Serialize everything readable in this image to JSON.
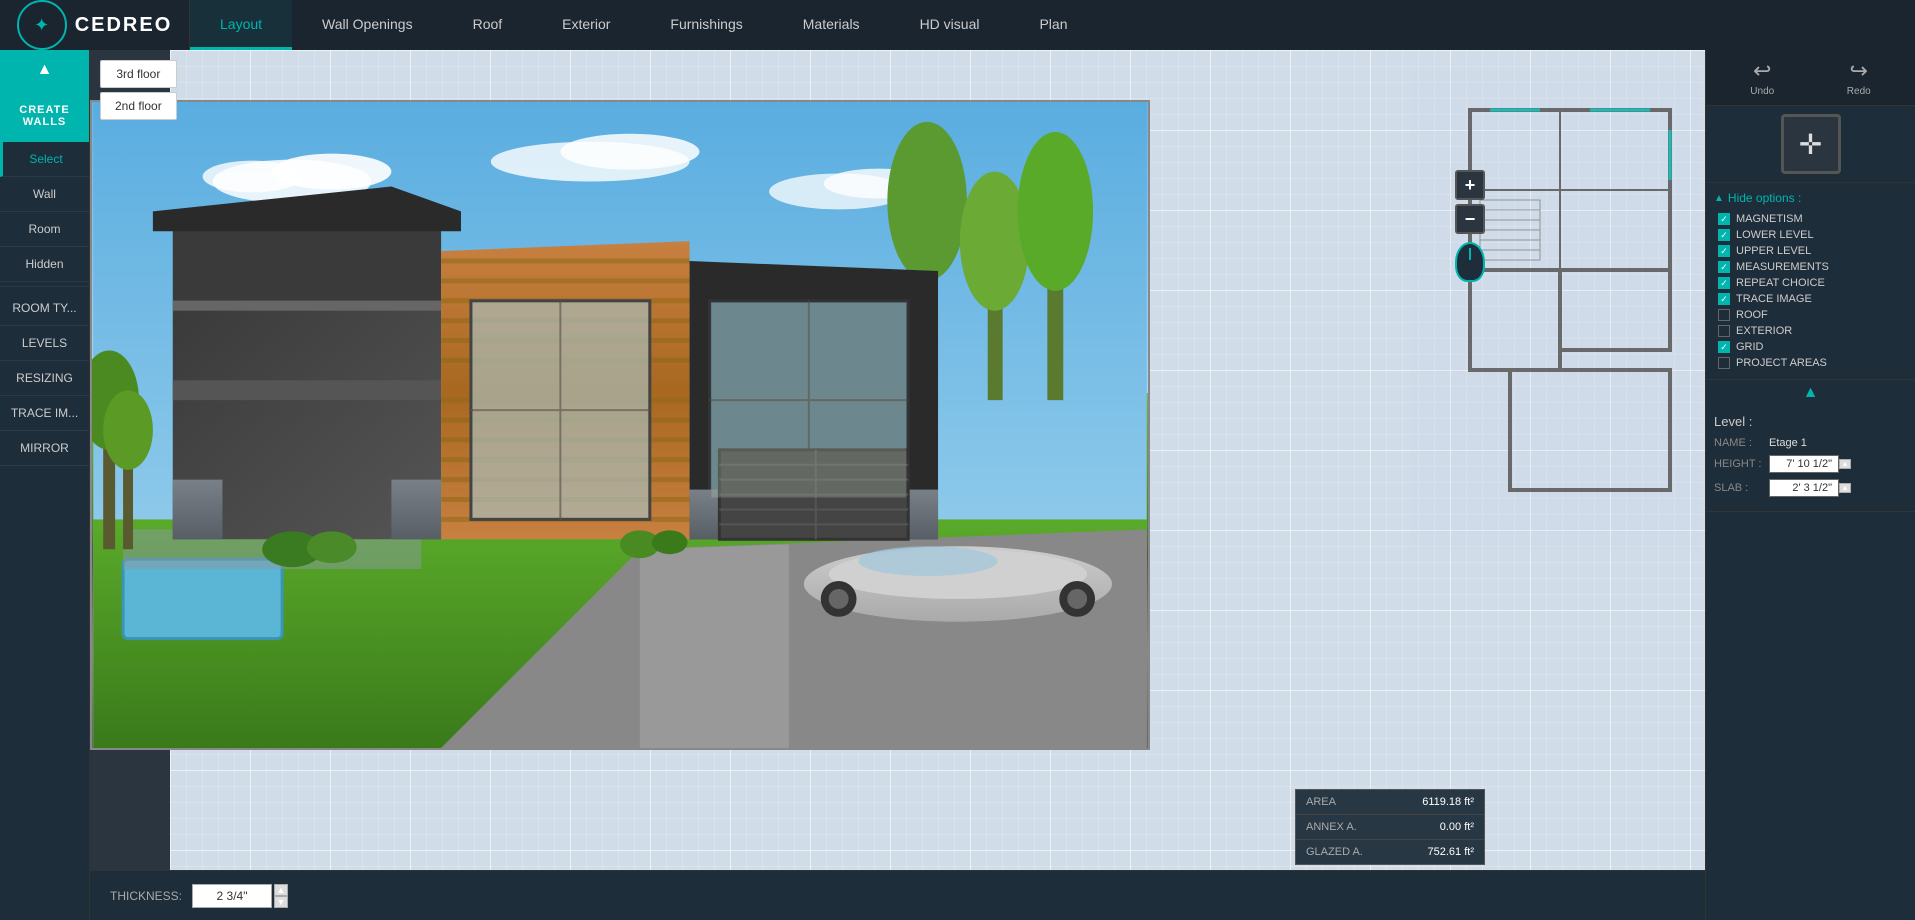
{
  "logo": {
    "text": "CEDREO"
  },
  "nav": {
    "tabs": [
      {
        "id": "layout",
        "label": "Layout",
        "active": true
      },
      {
        "id": "wall-openings",
        "label": "Wall Openings",
        "active": false
      },
      {
        "id": "roof",
        "label": "Roof",
        "active": false
      },
      {
        "id": "exterior",
        "label": "Exterior",
        "active": false
      },
      {
        "id": "furnishings",
        "label": "Furnishings",
        "active": false
      },
      {
        "id": "materials",
        "label": "Materials",
        "active": false
      },
      {
        "id": "hd-visual",
        "label": "HD visual",
        "active": false
      },
      {
        "id": "plan",
        "label": "Plan",
        "active": false
      }
    ]
  },
  "sidebar": {
    "create_walls_label": "CREATE WALLS",
    "items": [
      {
        "id": "select",
        "label": "Select",
        "active": true
      },
      {
        "id": "wall",
        "label": "Wall",
        "active": false
      },
      {
        "id": "room",
        "label": "Room",
        "active": false
      },
      {
        "id": "hidden",
        "label": "Hidden",
        "active": false
      },
      {
        "id": "room-type",
        "label": "ROOM TY...",
        "active": false
      },
      {
        "id": "levels",
        "label": "LEVELS",
        "active": false
      },
      {
        "id": "resizing",
        "label": "RESIZING",
        "active": false
      },
      {
        "id": "trace-image",
        "label": "TRACE IM...",
        "active": false
      },
      {
        "id": "mirror",
        "label": "MIRROR",
        "active": false
      }
    ]
  },
  "floors": [
    {
      "id": "3rd",
      "label": "3rd floor"
    },
    {
      "id": "2nd",
      "label": "2nd floor"
    }
  ],
  "undo_redo": {
    "undo_label": "Undo",
    "redo_label": "Redo"
  },
  "hide_options": {
    "header": "Hide options :",
    "items": [
      {
        "id": "magnetism",
        "label": "MAGNETISM",
        "checked": true
      },
      {
        "id": "lower-level",
        "label": "LOWER LEVEL",
        "checked": true
      },
      {
        "id": "upper-level",
        "label": "UPPER LEVEL",
        "checked": true
      },
      {
        "id": "measurements",
        "label": "MEASUREMENTS",
        "checked": true
      },
      {
        "id": "repeat-choice",
        "label": "REPEAT CHOICE",
        "checked": true
      },
      {
        "id": "trace-image",
        "label": "TRACE IMAGE",
        "checked": true
      },
      {
        "id": "roof",
        "label": "ROOF",
        "checked": false
      },
      {
        "id": "exterior",
        "label": "EXTERIOR",
        "checked": false
      },
      {
        "id": "grid",
        "label": "GRID",
        "checked": true
      },
      {
        "id": "project-areas",
        "label": "PROJECT AREAS",
        "checked": false
      }
    ]
  },
  "level": {
    "header": "Level :",
    "name_label": "NAME :",
    "name_value": "Etage 1",
    "height_label": "HEIGHT :",
    "height_value": "7' 10 1/2\"",
    "slab_label": "SLAB :",
    "slab_value": "2' 3 1/2\""
  },
  "area_info": [
    {
      "label": "AREA",
      "value": "6119.18 ft²"
    },
    {
      "label": "ANNEX A.",
      "value": "0.00 ft²"
    },
    {
      "label": "GLAZED A.",
      "value": "752.61 ft²"
    }
  ],
  "thickness": {
    "label": "THICKNESS:",
    "value": "2 3/4\""
  },
  "colors": {
    "teal": "#00b5ad",
    "dark_bg": "#1e2d3a",
    "mid_bg": "#2b3540"
  }
}
